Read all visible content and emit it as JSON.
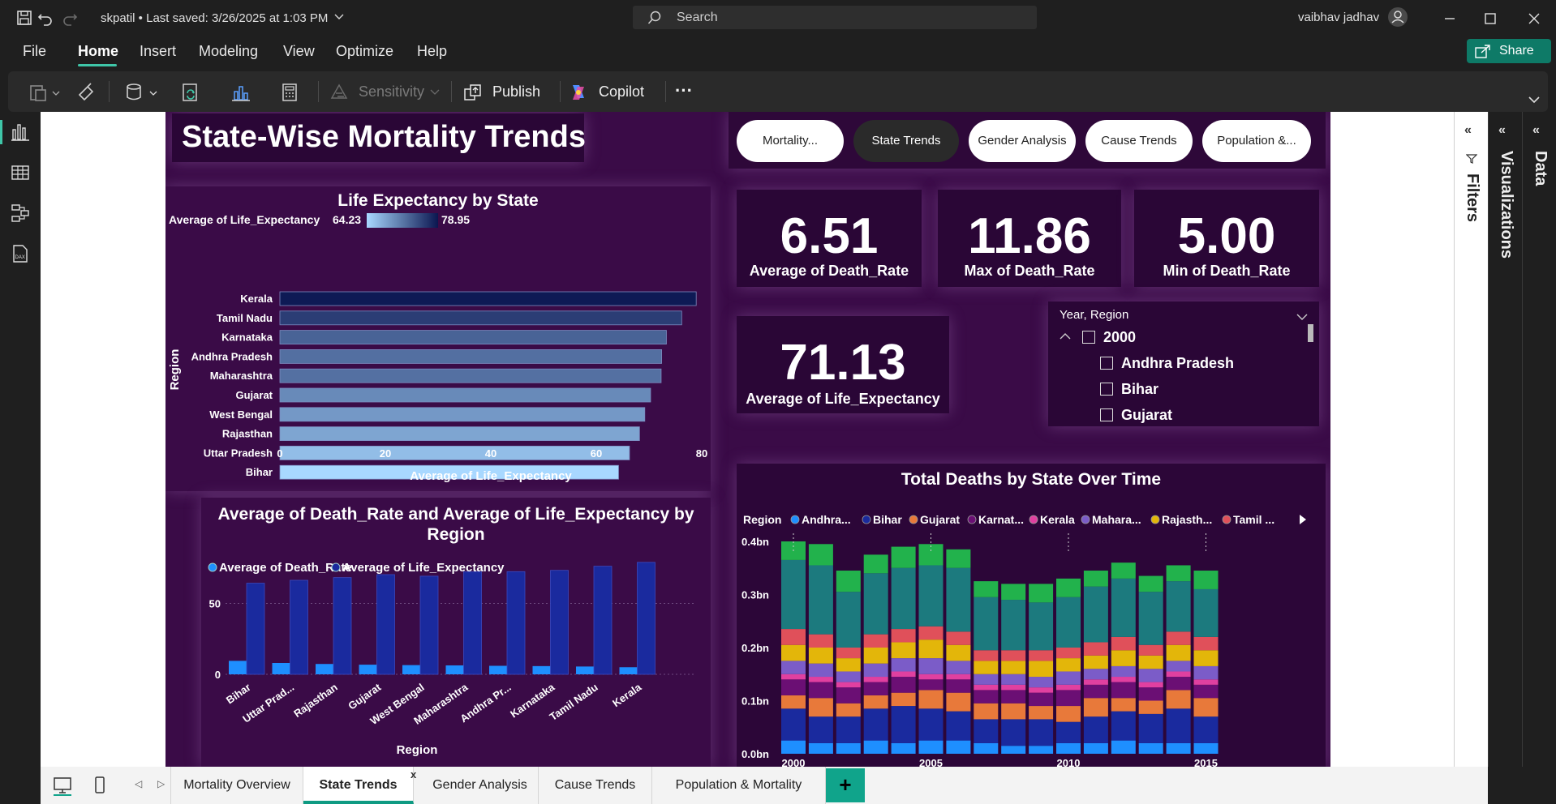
{
  "titlebar": {
    "file_title": "skpatil • Last saved: 3/26/2025 at 1:03 PM",
    "search_label": "Search",
    "user_name": "vaibhav jadhav"
  },
  "menu": {
    "items": [
      "File",
      "Home",
      "Insert",
      "Modeling",
      "View",
      "Optimize",
      "Help"
    ],
    "share_label": "Share"
  },
  "ribbon": {
    "sensitivity_label": "Sensitivity",
    "publish_label": "Publish",
    "copilot_label": "Copilot",
    "more_label": "···"
  },
  "panes": {
    "filters_label": "Filters",
    "visualizations_label": "Visualizations",
    "data_label": "Data"
  },
  "page_tabs": [
    "Mortality Overview",
    "State Trends",
    "Gender Analysis",
    "Cause Trends",
    "Population & Mortality"
  ],
  "page_tab_close": "x",
  "page_tab_add": "+",
  "report": {
    "title": "State-Wise Mortality Trends",
    "nav_buttons": [
      "Mortality...",
      "State Trends",
      "Gender Analysis",
      "Cause Trends",
      "Population &..."
    ],
    "kpis": [
      {
        "value": "6.51",
        "label": "Average of Death_Rate"
      },
      {
        "value": "11.86",
        "label": "Max of Death_Rate"
      },
      {
        "value": "5.00",
        "label": "Min of Death_Rate"
      },
      {
        "value": "71.13",
        "label": "Average of Life_Expectancy"
      }
    ],
    "slicer": {
      "title": "Year, Region",
      "year": "2000",
      "items": [
        "Andhra Pradesh",
        "Bihar",
        "Gujarat"
      ]
    }
  },
  "colors": {
    "report_bg": "#3a0b47",
    "card_bg": "#2a0636",
    "accent_teal": "#0e9a82"
  },
  "chart_data": [
    {
      "type": "bar",
      "orientation": "horizontal",
      "title": "Life Expectancy by State",
      "legend_title": "Average of Life_Expectancy",
      "legend_min": "64.23",
      "legend_max": "78.95",
      "ylabel": "Region",
      "xlabel": "Average of Life_Expectancy",
      "xlim": [
        0,
        80
      ],
      "xticks": [
        "0",
        "20",
        "40",
        "60",
        "80"
      ],
      "categories": [
        "Kerala",
        "Tamil Nadu",
        "Karnataka",
        "Andhra Pradesh",
        "Maharashtra",
        "Gujarat",
        "West Bengal",
        "Rajasthan",
        "Uttar Pradesh",
        "Bihar"
      ],
      "values": [
        78.95,
        76.2,
        73.3,
        72.4,
        72.3,
        70.3,
        69.2,
        68.2,
        66.3,
        64.23
      ]
    },
    {
      "type": "bar",
      "title": "Average of Death_Rate and Average of Life_Expectancy by Region",
      "xlabel": "Region",
      "ylim": [
        0,
        80
      ],
      "yticks": [
        "0",
        "50"
      ],
      "categories": [
        "Bihar",
        "Uttar Prad...",
        "Rajasthan",
        "Gujarat",
        "West Bengal",
        "Maharashtra",
        "Andhra Pr...",
        "Karnataka",
        "Tamil Nadu",
        "Kerala"
      ],
      "series": [
        {
          "name": "Average of Death_Rate",
          "color": "#1e8fff",
          "values": [
            9.5,
            8.0,
            7.3,
            6.8,
            6.5,
            6.3,
            6.0,
            5.8,
            5.5,
            5.0
          ]
        },
        {
          "name": "Average of Life_Expectancy",
          "color": "#1a2a9e",
          "values": [
            64.23,
            66.3,
            68.2,
            70.3,
            69.2,
            72.3,
            72.4,
            73.3,
            76.2,
            78.95
          ]
        }
      ]
    },
    {
      "type": "bar",
      "stacked": true,
      "title": "Total Deaths by State Over Time",
      "legend_title": "Region",
      "xlabel": "Year",
      "ylim": [
        0,
        0.4
      ],
      "yticks": [
        "0.0bn",
        "0.1bn",
        "0.2bn",
        "0.3bn",
        "0.4bn"
      ],
      "xticks": [
        "2000",
        "2005",
        "2010",
        "2015"
      ],
      "categories": [
        2000,
        2001,
        2002,
        2003,
        2004,
        2005,
        2006,
        2007,
        2008,
        2009,
        2010,
        2011,
        2012,
        2013,
        2014,
        2015
      ],
      "legend_labels": [
        "Andhra...",
        "Bihar",
        "Gujarat",
        "Karnat...",
        "Kerala",
        "Mahara...",
        "Rajasth...",
        "Tamil ..."
      ],
      "series": [
        {
          "name": "Andhra Pradesh",
          "color": "#1e8fff",
          "values": [
            0.025,
            0.02,
            0.02,
            0.025,
            0.02,
            0.025,
            0.025,
            0.02,
            0.015,
            0.015,
            0.02,
            0.02,
            0.025,
            0.02,
            0.02,
            0.02
          ]
        },
        {
          "name": "Bihar",
          "color": "#1a2a9e",
          "values": [
            0.06,
            0.05,
            0.05,
            0.06,
            0.07,
            0.06,
            0.055,
            0.045,
            0.05,
            0.05,
            0.04,
            0.05,
            0.055,
            0.055,
            0.065,
            0.05
          ]
        },
        {
          "name": "Gujarat",
          "color": "#e8793a",
          "values": [
            0.025,
            0.035,
            0.025,
            0.025,
            0.025,
            0.035,
            0.035,
            0.03,
            0.03,
            0.025,
            0.03,
            0.035,
            0.025,
            0.025,
            0.035,
            0.035
          ]
        },
        {
          "name": "Karnataka",
          "color": "#6b0f74",
          "values": [
            0.03,
            0.03,
            0.03,
            0.025,
            0.03,
            0.02,
            0.025,
            0.025,
            0.025,
            0.025,
            0.03,
            0.025,
            0.03,
            0.025,
            0.025,
            0.025
          ]
        },
        {
          "name": "Kerala",
          "color": "#e040a0",
          "values": [
            0.01,
            0.01,
            0.01,
            0.01,
            0.01,
            0.01,
            0.01,
            0.01,
            0.01,
            0.01,
            0.01,
            0.01,
            0.01,
            0.01,
            0.01,
            0.01
          ]
        },
        {
          "name": "Maharashtra",
          "color": "#7b5cc8",
          "values": [
            0.025,
            0.025,
            0.02,
            0.025,
            0.025,
            0.03,
            0.025,
            0.02,
            0.02,
            0.02,
            0.025,
            0.02,
            0.02,
            0.025,
            0.02,
            0.025
          ]
        },
        {
          "name": "Rajasthan",
          "color": "#e3b60a",
          "values": [
            0.03,
            0.03,
            0.025,
            0.03,
            0.03,
            0.035,
            0.03,
            0.025,
            0.025,
            0.03,
            0.025,
            0.025,
            0.03,
            0.025,
            0.03,
            0.03
          ]
        },
        {
          "name": "Tamil Nadu",
          "color": "#e0505a",
          "values": [
            0.03,
            0.025,
            0.02,
            0.025,
            0.025,
            0.025,
            0.025,
            0.02,
            0.02,
            0.02,
            0.02,
            0.025,
            0.025,
            0.02,
            0.025,
            0.025
          ]
        },
        {
          "name": "Uttar Pradesh",
          "color": "#1c7a7e",
          "values": [
            0.13,
            0.13,
            0.105,
            0.115,
            0.115,
            0.115,
            0.12,
            0.1,
            0.095,
            0.09,
            0.095,
            0.105,
            0.11,
            0.1,
            0.095,
            0.09
          ]
        },
        {
          "name": "West Bengal",
          "color": "#22b24c",
          "values": [
            0.035,
            0.04,
            0.04,
            0.035,
            0.04,
            0.04,
            0.035,
            0.03,
            0.03,
            0.035,
            0.035,
            0.03,
            0.03,
            0.03,
            0.03,
            0.035
          ]
        }
      ]
    }
  ]
}
